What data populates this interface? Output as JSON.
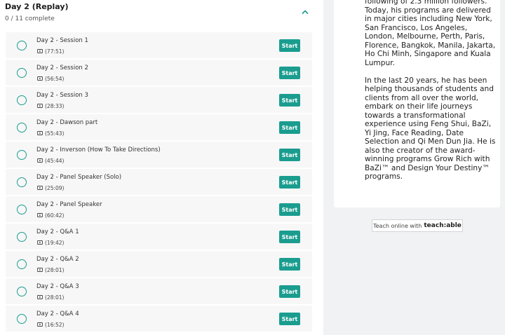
{
  "section": {
    "title": "Day 2 (Replay)",
    "progress": "0 / 11 complete",
    "lectures": [
      {
        "title": "Day 2 - Session 1",
        "duration": "(77:51)",
        "action": "Start"
      },
      {
        "title": "Day 2 - Session 2",
        "duration": "(56:54)",
        "action": "Start"
      },
      {
        "title": "Day 2 - Session 3",
        "duration": "(28:33)",
        "action": "Start"
      },
      {
        "title": "Day 2 - Dawson part",
        "duration": "(55:43)",
        "action": "Start"
      },
      {
        "title": "Day 2 - Inverson (How To Take Directions)",
        "duration": "(45:44)",
        "action": "Start"
      },
      {
        "title": "Day 2 - Panel Speaker (Solo)",
        "duration": "(25:09)",
        "action": "Start"
      },
      {
        "title": "Day 2 - Panel Speaker",
        "duration": "(60:42)",
        "action": "Start"
      },
      {
        "title": "Day 2 - Q&A 1",
        "duration": "(19:42)",
        "action": "Start"
      },
      {
        "title": "Day 2 - Q&A 2",
        "duration": "(28:01)",
        "action": "Start"
      },
      {
        "title": "Day 2 - Q&A 3",
        "duration": "(28:01)",
        "action": "Start"
      },
      {
        "title": "Day 2 - Q&A 4",
        "duration": "(16:52)",
        "action": "Start"
      }
    ]
  },
  "bio": {
    "paragraph1": "following of 2.3 million followers. Today, his programs are delivered in major cities including New York, San Francisco, Los Angeles, London, Melbourne, Perth, Paris, Florence, Bangkok, Manila, Jakarta, Ho Chi Minh, Singapore and Kuala Lumpur.",
    "paragraph2": "In the last 20 years, he has been helping thousands of students and clients from all over the world, embark on their life journeys towards a transformational experience using Feng Shui, BaZi, Yi Jing, Face Reading, Date Selection and Qi Men Dun Jia. He is also the creator of the award-winning programs Grow Rich with BaZi™ and Design Your Destiny™ programs."
  },
  "footer": {
    "teach_prefix": "Teach online with",
    "teach_brand": "teach:able"
  },
  "colors": {
    "accent": "#1a9d8f",
    "page_bg": "#f1f2f4"
  }
}
